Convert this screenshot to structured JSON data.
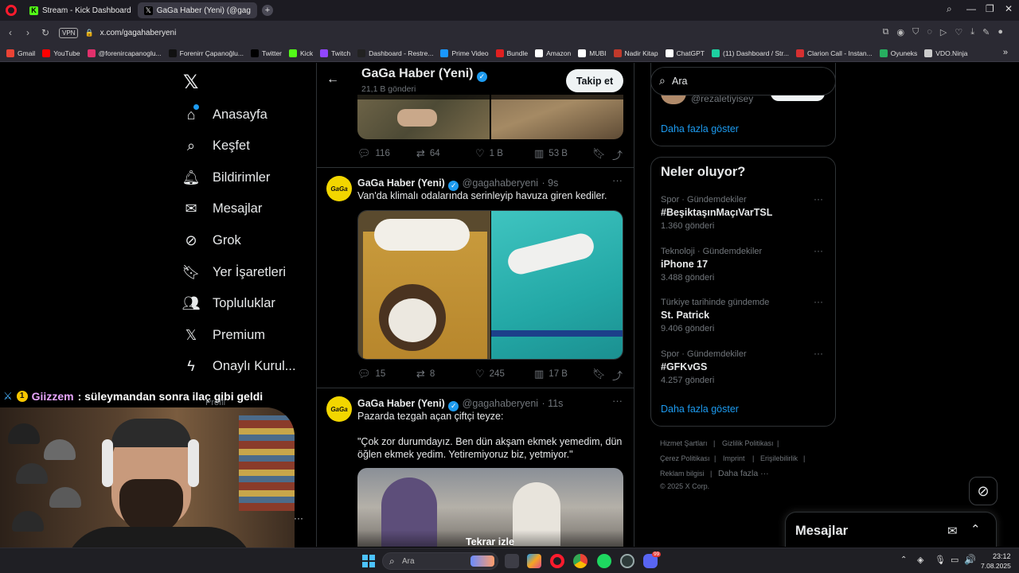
{
  "browser": {
    "tabs": [
      {
        "label": "Stream - Kick Dashboard",
        "active": false
      },
      {
        "label": "GaGa Haber (Yeni) (@gag",
        "active": true
      }
    ],
    "vpn_label": "VPN",
    "url": "x.com/gagahaberyeni",
    "bookmarks": [
      {
        "label": "Gmail",
        "color": "#ea4335"
      },
      {
        "label": "YouTube",
        "color": "#ff0000"
      },
      {
        "label": "@forenircapanoglu...",
        "color": "#e1306c"
      },
      {
        "label": "Forenirr Çapanoğlu...",
        "color": "#111111"
      },
      {
        "label": "Twitter",
        "color": "#000000"
      },
      {
        "label": "Kick",
        "color": "#53fc18"
      },
      {
        "label": "Twitch",
        "color": "#9146ff"
      },
      {
        "label": "Dashboard - Restre...",
        "color": "#222222"
      },
      {
        "label": "Prime Video",
        "color": "#1a98ff"
      },
      {
        "label": "Bundle",
        "color": "#e02020"
      },
      {
        "label": "Amazon",
        "color": "#ffffff"
      },
      {
        "label": "MUBI",
        "color": "#ffffff"
      },
      {
        "label": "Nadir Kitap",
        "color": "#c0392b"
      },
      {
        "label": "ChatGPT",
        "color": "#ffffff"
      },
      {
        "label": "(11) Dashboard / Str...",
        "color": "#1dd1a1"
      },
      {
        "label": "Clarion Call - Instan...",
        "color": "#d63031"
      },
      {
        "label": "Oyuneks",
        "color": "#27ae60"
      },
      {
        "label": "VDO.Ninja",
        "color": "#cccccc"
      }
    ]
  },
  "sidebar": {
    "items": [
      {
        "label": "Anasayfa",
        "icon": "home-icon"
      },
      {
        "label": "Keşfet",
        "icon": "search-icon"
      },
      {
        "label": "Bildirimler",
        "icon": "bell-icon"
      },
      {
        "label": "Mesajlar",
        "icon": "mail-icon"
      },
      {
        "label": "Grok",
        "icon": "grok-icon"
      },
      {
        "label": "Yer İşaretleri",
        "icon": "bookmark-icon"
      },
      {
        "label": "Topluluklar",
        "icon": "people-icon"
      },
      {
        "label": "Premium",
        "icon": "x-icon"
      },
      {
        "label": "Onaylı Kurul...",
        "icon": "lightning-icon"
      }
    ]
  },
  "profile_header": {
    "name": "GaGa Haber (Yeni)",
    "post_count": "21,1 B gönderi",
    "follow_label": "Takip et"
  },
  "tweets": [
    {
      "replies": "116",
      "reposts": "64",
      "likes": "1 B",
      "views": "53 B"
    },
    {
      "author": "GaGa Haber (Yeni)",
      "handle": "@gagahaberyeni",
      "time": "· 9s",
      "avatar_text": "GaGa",
      "text": "Van'da klimalı odalarında serinleyip havuza giren kediler.",
      "replies": "15",
      "reposts": "8",
      "likes": "245",
      "views": "17 B"
    },
    {
      "author": "GaGa Haber (Yeni)",
      "handle": "@gagahaberyeni",
      "time": "· 11s",
      "avatar_text": "GaGa",
      "text": "Pazarda tezgah açan çiftçi teyze:",
      "quote": "\"Çok zor durumdayız. Ben dün akşam ekmek yemedim, dün öğlen ekmek yedim. Yetiremiyoruz biz, yetmiyor.\"",
      "video_label": "Tekrar izle"
    }
  ],
  "right": {
    "search_value": "Ara",
    "who_handle": "@rezaletiyisey",
    "show_more_1": "Daha fazla göster",
    "trends_title": "Neler oluyor?",
    "trends": [
      {
        "category": "Spor · Gündemdekiler",
        "name": "#BeşiktaşınMaçıVarTSL",
        "count": "1.360 gönderi"
      },
      {
        "category": "Teknoloji · Gündemdekiler",
        "name": "iPhone 17",
        "count": "3.488 gönderi"
      },
      {
        "category": "Türkiye tarihinde gündemde",
        "name": "St. Patrick",
        "count": "9.406 gönderi"
      },
      {
        "category": "Spor · Gündemdekiler",
        "name": "#GFKvGS",
        "count": "4.257 gönderi"
      }
    ],
    "show_more_2": "Daha fazla göster",
    "footer": {
      "terms": "Hizmet Şartları",
      "privacy": "Gizlilik Politikası",
      "cookies": "Çerez Politikası",
      "imprint": "Imprint",
      "accessibility": "Erişilebilirlik",
      "ads": "Reklam bilgisi",
      "more": "Daha fazla ···",
      "copyright": "© 2025 X Corp."
    },
    "messages_title": "Mesajlar"
  },
  "overlay": {
    "chat_user": "Giizzem",
    "chat_message": ": süleymandan sonra ilaç gibi geldi",
    "partial_text": "Profil"
  },
  "taskbar": {
    "search_placeholder": "Ara",
    "time": "23:12",
    "date": "7.08.2025",
    "discord_badge": "99"
  },
  "colors": {
    "accent": "#1d9bf0",
    "link": "#1d9bf0",
    "muted": "#71767b",
    "border": "#2f3336"
  }
}
